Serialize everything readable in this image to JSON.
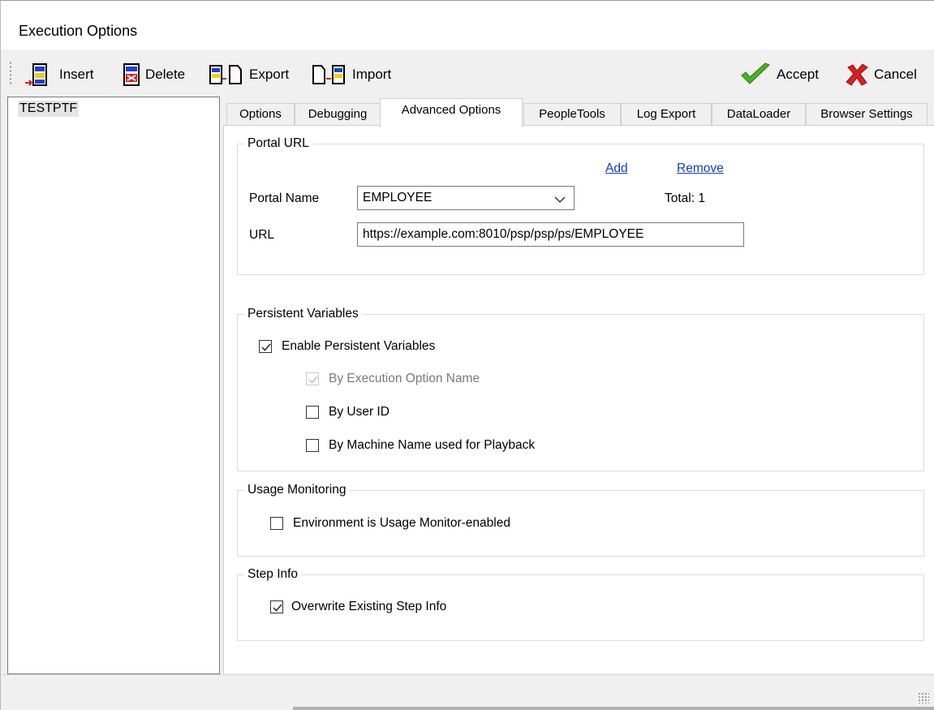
{
  "window": {
    "title": "Execution Options"
  },
  "toolbar": {
    "insert_label": "Insert",
    "delete_label": "Delete",
    "export_label": "Export",
    "import_label": "Import",
    "accept_label": "Accept",
    "cancel_label": "Cancel"
  },
  "left_list": {
    "items": [
      "TESTPTF"
    ]
  },
  "tabs": [
    {
      "label": "Options",
      "active": false
    },
    {
      "label": "Debugging",
      "active": false
    },
    {
      "label": "Advanced Options",
      "active": true
    },
    {
      "label": "PeopleTools",
      "active": false
    },
    {
      "label": "Log Export",
      "active": false
    },
    {
      "label": "DataLoader",
      "active": false
    },
    {
      "label": "Browser Settings",
      "active": false
    }
  ],
  "portal_url": {
    "group_label": "Portal URL",
    "add_link": "Add",
    "remove_link": "Remove",
    "portal_name_label": "Portal Name",
    "portal_name_value": "EMPLOYEE",
    "total_text": "Total: 1",
    "url_label": "URL",
    "url_value": "https://example.com:8010/psp/psp/ps/EMPLOYEE"
  },
  "persistent_variables": {
    "group_label": "Persistent Variables",
    "enable_label": "Enable Persistent Variables",
    "enable_checked": true,
    "by_exec_option_label": "By Execution Option Name",
    "by_exec_option_checked": true,
    "by_exec_option_disabled": true,
    "by_user_id_label": "By User ID",
    "by_user_id_checked": false,
    "by_machine_label": "By Machine Name used for Playback",
    "by_machine_checked": false
  },
  "usage_monitoring": {
    "group_label": "Usage Monitoring",
    "env_label": "Environment is Usage Monitor-enabled",
    "env_checked": false
  },
  "step_info": {
    "group_label": "Step Info",
    "overwrite_label": "Overwrite Existing Step Info",
    "overwrite_checked": true
  },
  "colors": {
    "link": "#0f3ec8",
    "accept_green": "#4caf23",
    "cancel_red": "#d42020"
  }
}
